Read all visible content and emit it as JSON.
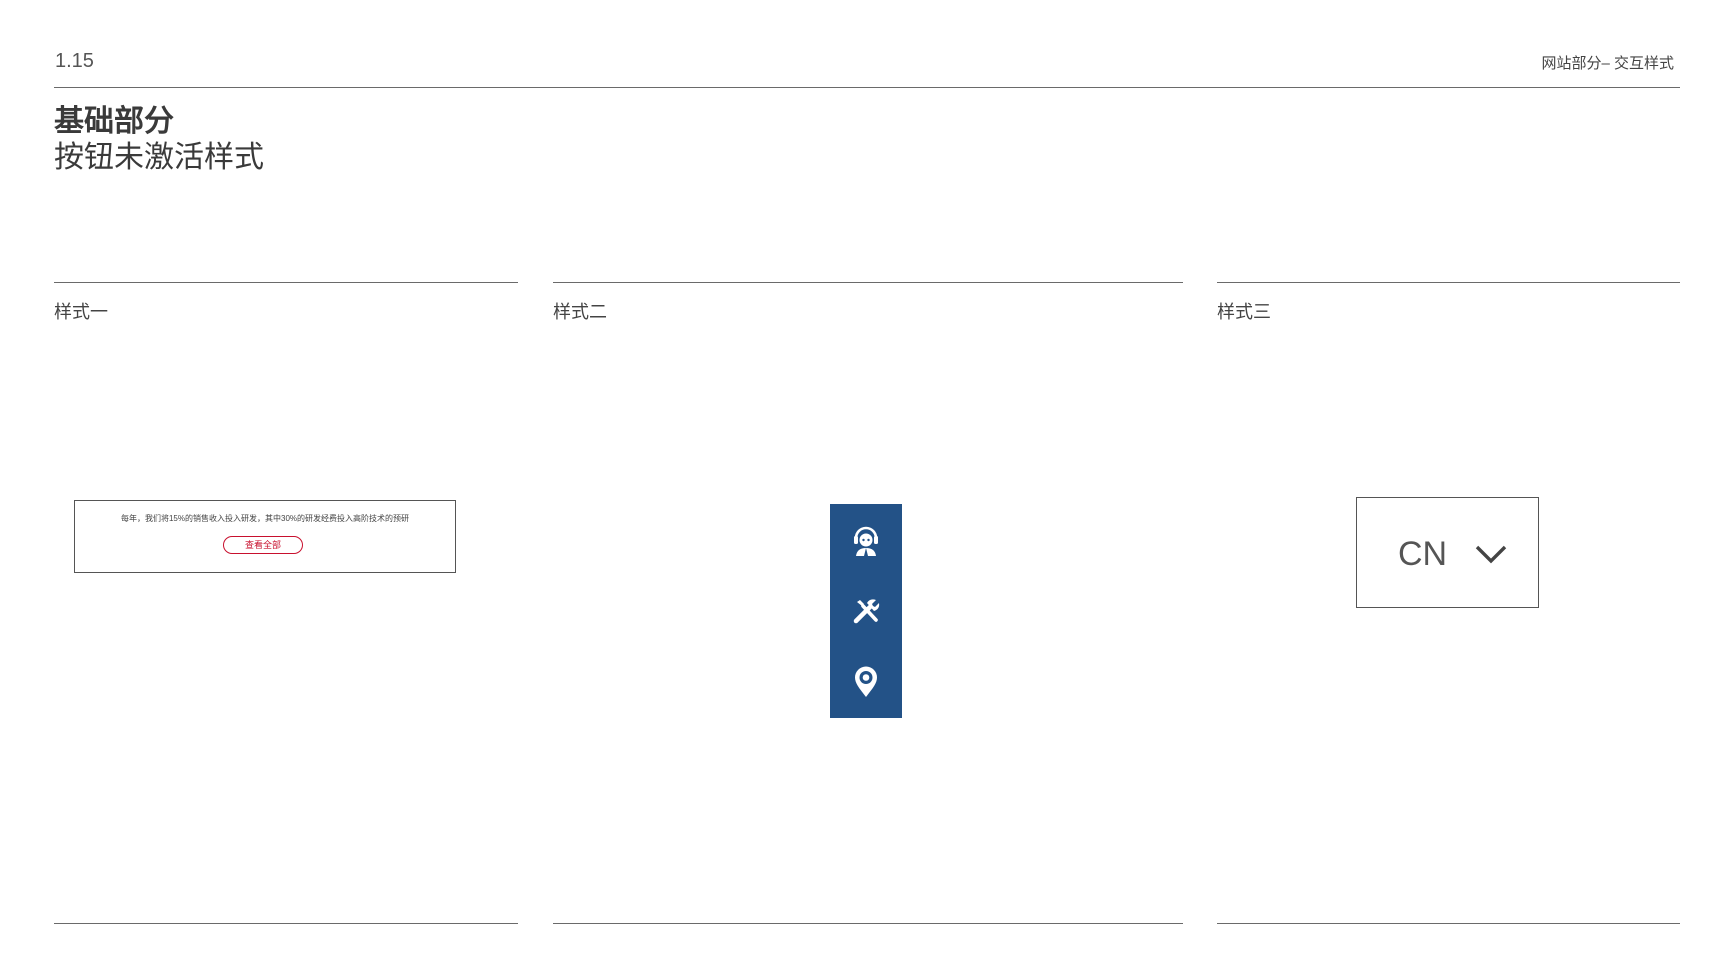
{
  "header": {
    "page_number": "1.15",
    "section": "网站部分– 交互样式"
  },
  "title": {
    "main": "基础部分",
    "sub": "按钮未激活样式"
  },
  "columns": [
    {
      "label": "样式一"
    },
    {
      "label": "样式二"
    },
    {
      "label": "样式三"
    }
  ],
  "style1": {
    "text": "每年，我们将15%的销售收入投入研发，其中30%的研发经费投入高阶技术的预研",
    "button_label": "查看全部",
    "button_color": "#c8102e"
  },
  "style2": {
    "background": "#235287",
    "icons": [
      "customer-service-icon",
      "tools-icon",
      "location-pin-icon"
    ]
  },
  "style3": {
    "selected_value": "CN",
    "icon": "chevron-down-icon"
  }
}
